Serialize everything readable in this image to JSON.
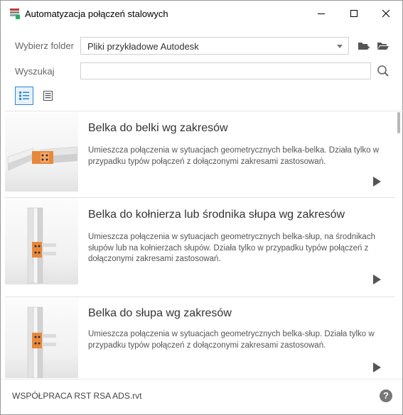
{
  "window": {
    "title": "Automatyzacja połączeń stalowych",
    "icon": "steel-connection-app-icon"
  },
  "toolbar": {
    "folder_label": "Wybierz folder",
    "folder_value": "Pliki przykładowe Autodesk",
    "search_label": "Wyszukaj",
    "search_value": "",
    "search_placeholder": ""
  },
  "items": [
    {
      "title": "Belka do belki wg zakresów",
      "description": "Umieszcza połączenia w sytuacjach geometrycznych belka-belka. Działa tylko w przypadku typów połączeń z dołączonymi zakresami zastosowań."
    },
    {
      "title": "Belka do kołnierza lub środnika słupa wg zakresów",
      "description": "Umieszcza połączenia w sytuacjach geometrycznych belka-słup, na środnikach słupów lub na kołnierzach słupów. Działa tylko w przypadku typów połączeń z dołączonymi zakresami zastosowań."
    },
    {
      "title": "Belka do słupa wg zakresów",
      "description": "Umieszcza połączenia w sytuacjach geometrycznych belka-słup. Działa tylko w przypadku typów połączeń z dołączonymi zakresami zastosowań."
    }
  ],
  "footer": {
    "file_name": "WSPÓŁPRACA RST RSA ADS.rvt",
    "help": "?"
  },
  "colors": {
    "accent": "#2a86d8",
    "connection": "#e8883a"
  }
}
